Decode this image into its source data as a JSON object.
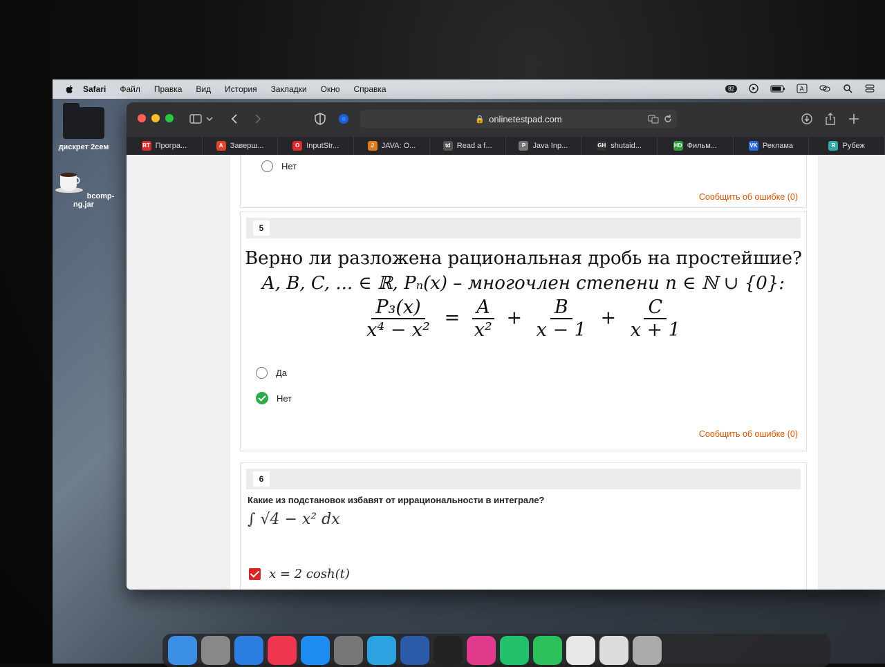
{
  "menubar": {
    "app": "Safari",
    "items": [
      "Файл",
      "Правка",
      "Вид",
      "История",
      "Закладки",
      "Окно",
      "Справка"
    ],
    "status_badge": "82"
  },
  "desktop": [
    {
      "label": "дискрет 2сем",
      "icon": "folder-icon"
    },
    {
      "label": "bcomp-ng.jar",
      "icon": "java-cup-icon"
    }
  ],
  "browser": {
    "url": "onlinetestpad.com",
    "tabs": [
      {
        "label": "Програ...",
        "favicon": "BT",
        "color": "#d9302c"
      },
      {
        "label": "Заверш...",
        "favicon": "A",
        "color": "#e0452b"
      },
      {
        "label": "InputStr...",
        "favicon": "O",
        "color": "#e02c2c"
      },
      {
        "label": "JAVA: O...",
        "favicon": "J",
        "color": "#e07b1c"
      },
      {
        "label": "Read a f...",
        "favicon": "td",
        "color": "#555"
      },
      {
        "label": "Java Inp...",
        "favicon": "P",
        "color": "#777"
      },
      {
        "label": "shutaid...",
        "favicon": "GH",
        "color": "#333"
      },
      {
        "label": "Фильм...",
        "favicon": "HD",
        "color": "#2e9e3c"
      },
      {
        "label": "Реклама",
        "favicon": "VK",
        "color": "#2c6ce0"
      },
      {
        "label": "Рубеж",
        "favicon": "R",
        "color": "#3aa"
      }
    ]
  },
  "prev_question": {
    "option_label": "Нет",
    "report": "Сообщить об ошибке (0)"
  },
  "question5": {
    "number": "5",
    "line1": "Верно ли разложена рациональная дробь на простейшие?",
    "line2": "A, B, C, ... ∈ ℝ,  Pₙ(x) – многочлен степени n ∈ ℕ ∪ {0}:",
    "lhs_num": "P₃(x)",
    "lhs_den": "x⁴ − x²",
    "eq": "=",
    "t1_num": "A",
    "t1_den": "x²",
    "plus": "+",
    "t2_num": "B",
    "t2_den": "x − 1",
    "t3_num": "C",
    "t3_den": "x + 1",
    "options": [
      {
        "label": "Да",
        "selected": false
      },
      {
        "label": "Нет",
        "selected": true
      }
    ],
    "report": "Сообщить об ошибке (0)"
  },
  "question6": {
    "number": "6",
    "text": "Какие из подстановок избавят от иррациональности в интеграле?",
    "integral": "∫ √4 − x²  dx",
    "option1": "x = 2 cosh(t)"
  },
  "dock": [
    "Finder",
    "Launchpad",
    "Safari",
    "Music",
    "App Store",
    "System Preferences",
    "Telegram",
    "Word",
    "Terminal",
    "IntelliJ IDEA",
    "PyCharm",
    "FaceTime",
    "Chrome",
    "Documents",
    "Trash"
  ]
}
